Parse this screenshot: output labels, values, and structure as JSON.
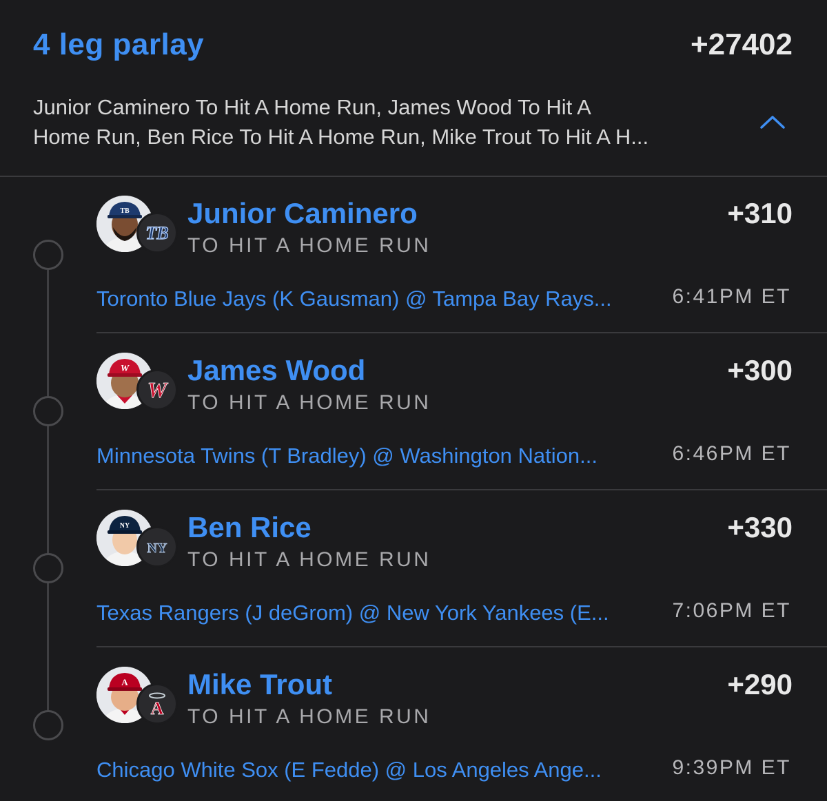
{
  "header": {
    "title": "4 leg parlay",
    "total_odds": "+27402",
    "summary_line1": "Junior Caminero To Hit A Home Run, James Wood To Hit A",
    "summary_line2": "Home Run, Ben Rice To Hit A Home Run, Mike Trout To Hit A H...",
    "collapse_icon": "chevron-up-icon"
  },
  "colors": {
    "background": "#1b1b1d",
    "accent": "#3f8ff3",
    "odds_text": "#e8e8e8",
    "secondary_text": "#a9a9ac"
  },
  "legs": [
    {
      "player": "Junior Caminero",
      "market": "TO HIT A HOME RUN",
      "odds": "+310",
      "matchup": "Toronto Blue Jays (K Gausman) @ Tampa Bay Rays...",
      "time": "6:41PM ET",
      "team_logo_text": "TB",
      "team_color": "#1d3a6e"
    },
    {
      "player": "James Wood",
      "market": "TO HIT A HOME RUN",
      "odds": "+300",
      "matchup": "Minnesota Twins (T Bradley) @ Washington Nation...",
      "time": "6:46PM ET",
      "team_logo_text": "W",
      "team_color": "#c8102e"
    },
    {
      "player": "Ben Rice",
      "market": "TO HIT A HOME RUN",
      "odds": "+330",
      "matchup": "Texas Rangers (J deGrom) @ New York Yankees (E...",
      "time": "7:06PM ET",
      "team_logo_text": "NY",
      "team_color": "#0c2340"
    },
    {
      "player": "Mike Trout",
      "market": "TO HIT A HOME RUN",
      "odds": "+290",
      "matchup": "Chicago White Sox (E Fedde) @ Los Angeles Ange...",
      "time": "9:39PM ET",
      "team_logo_text": "A",
      "team_color": "#ba0021"
    }
  ]
}
